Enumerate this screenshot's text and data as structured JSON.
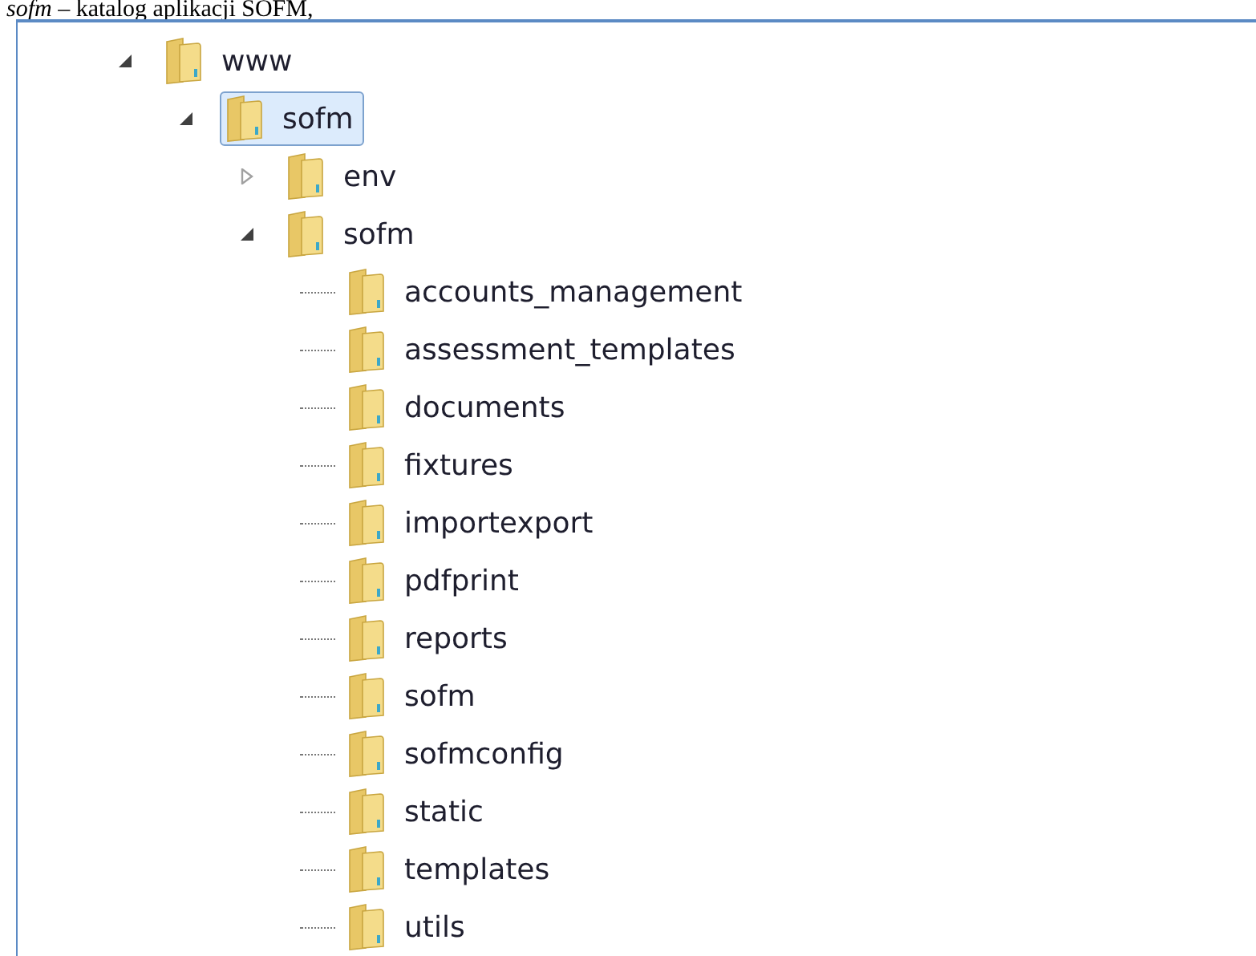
{
  "caption": "*sofm* – katalog aplikacji SOFM,",
  "tree": [
    {
      "label": "www",
      "expanded": true,
      "selected": false,
      "children": [
        {
          "label": "sofm",
          "expanded": true,
          "selected": true,
          "children": [
            {
              "label": "env",
              "expanded": false,
              "selected": false
            },
            {
              "label": "sofm",
              "expanded": true,
              "selected": false,
              "children": [
                {
                  "label": "accounts_management",
                  "selected": false
                },
                {
                  "label": "assessment_templates",
                  "selected": false
                },
                {
                  "label": "documents",
                  "selected": false
                },
                {
                  "label": "fixtures",
                  "selected": false
                },
                {
                  "label": "importexport",
                  "selected": false
                },
                {
                  "label": "pdfprint",
                  "selected": false
                },
                {
                  "label": "reports",
                  "selected": false
                },
                {
                  "label": "sofm",
                  "selected": false
                },
                {
                  "label": "sofmconfig",
                  "selected": false
                },
                {
                  "label": "static",
                  "selected": false
                },
                {
                  "label": "templates",
                  "selected": false
                },
                {
                  "label": "utils",
                  "selected": false
                }
              ]
            }
          ]
        }
      ]
    }
  ]
}
